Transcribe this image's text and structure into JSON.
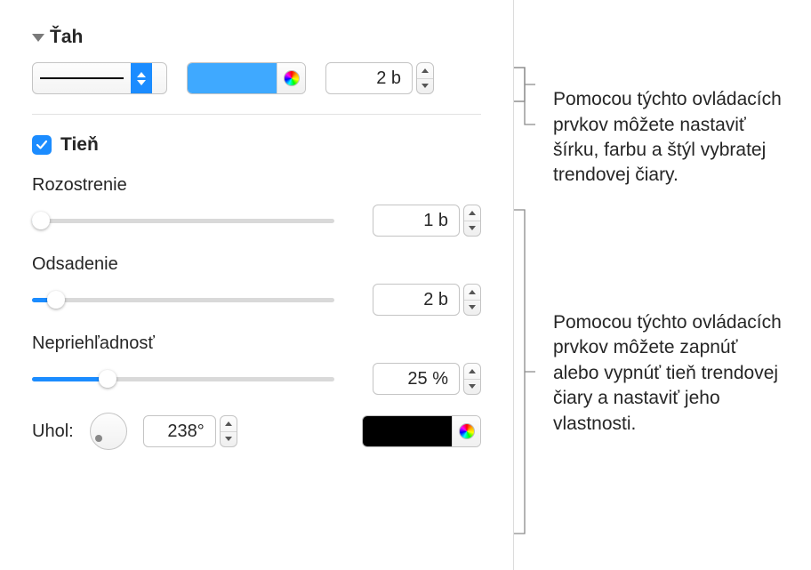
{
  "stroke": {
    "section_title": "Ťah",
    "width_value": "2 b",
    "color_hex": "#3fa9ff"
  },
  "shadow": {
    "checkbox_label": "Tieň",
    "checked": true,
    "blur_label": "Rozostrenie",
    "blur_value": "1 b",
    "blur_fill_pct": 3,
    "offset_label": "Odsadenie",
    "offset_value": "2 b",
    "offset_fill_pct": 8,
    "opacity_label": "Nepriehľadnosť",
    "opacity_value": "25 %",
    "opacity_fill_pct": 25,
    "angle_label": "Uhol:",
    "angle_value": "238°",
    "color_hex": "#000000"
  },
  "callouts": {
    "stroke_text": "Pomocou týchto ovládacích prvkov môžete nastaviť šírku, farbu a štýl vybratej trendovej čiary.",
    "shadow_text": "Pomocou týchto ovládacích prvkov môžete zapnúť alebo vypnúť tieň trendovej čiary a nastaviť jeho vlastnosti."
  }
}
